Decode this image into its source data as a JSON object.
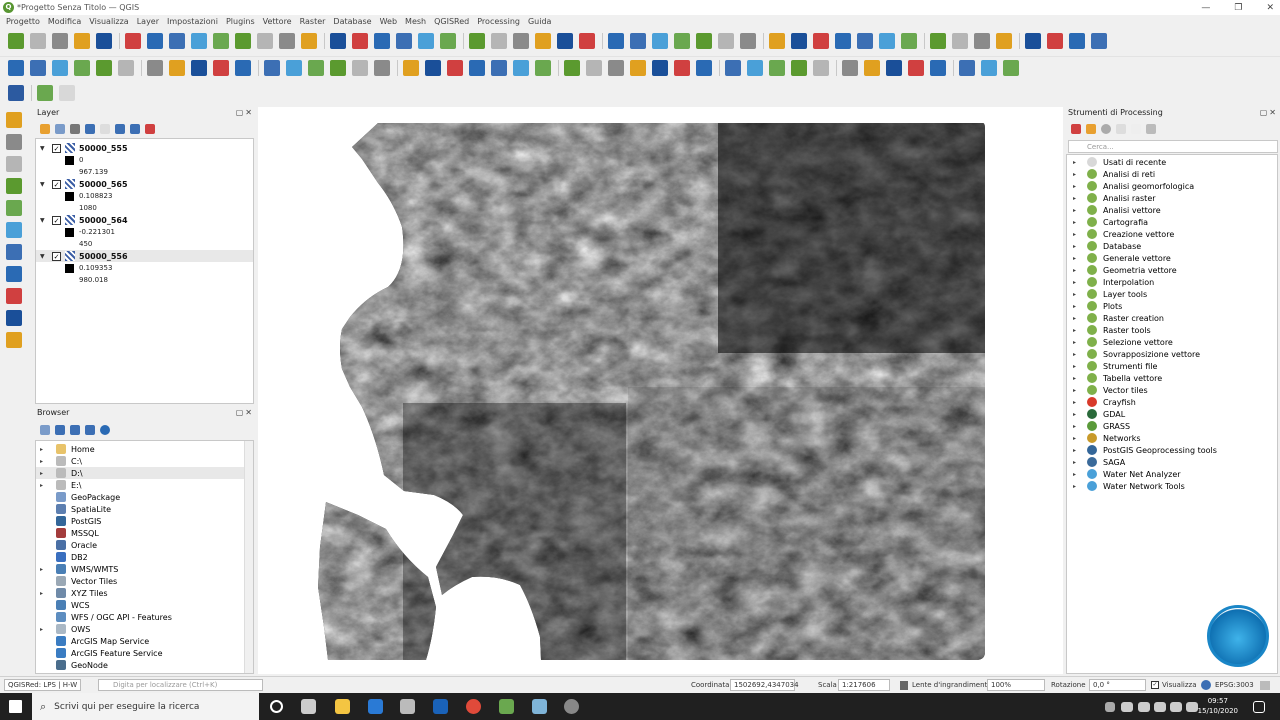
{
  "window": {
    "title": "*Progetto Senza Titolo — QGIS",
    "logo": "Q",
    "controls": [
      "—",
      "❐",
      "✕"
    ]
  },
  "menu": [
    "Progetto",
    "Modifica",
    "Visualizza",
    "Layer",
    "Impostazioni",
    "Plugins",
    "Vettore",
    "Raster",
    "Database",
    "Web",
    "Mesh",
    "QGISRed",
    "Processing",
    "Guida"
  ],
  "layers_panel": {
    "title": "Layer",
    "layers": [
      {
        "name": "50000_555",
        "min": "0",
        "max": "967.139"
      },
      {
        "name": "50000_565",
        "min": "0.108823",
        "max": "1080"
      },
      {
        "name": "50000_564",
        "min": "-0.221301",
        "max": "450"
      },
      {
        "name": "50000_556",
        "min": "0.109353",
        "max": "980.018"
      }
    ]
  },
  "browser_panel": {
    "title": "Browser",
    "items": [
      {
        "label": "Home",
        "expand": "▸",
        "icon": "folder-icon",
        "color": "#e8c36a"
      },
      {
        "label": "C:\\",
        "expand": "▸",
        "icon": "drive-icon",
        "color": "#bbbbbb"
      },
      {
        "label": "D:\\",
        "expand": "▸",
        "icon": "drive-icon",
        "color": "#bbbbbb"
      },
      {
        "label": "E:\\",
        "expand": "▸",
        "icon": "drive-icon",
        "color": "#bbbbbb"
      },
      {
        "label": "GeoPackage",
        "expand": "",
        "icon": "geopackage-icon",
        "color": "#7a9bc9"
      },
      {
        "label": "SpatiaLite",
        "expand": "",
        "icon": "spatialite-icon",
        "color": "#5d7fb0"
      },
      {
        "label": "PostGIS",
        "expand": "",
        "icon": "postgis-icon",
        "color": "#336699"
      },
      {
        "label": "MSSQL",
        "expand": "",
        "icon": "mssql-icon",
        "color": "#a33c3c"
      },
      {
        "label": "Oracle",
        "expand": "",
        "icon": "oracle-icon",
        "color": "#4a6fa5"
      },
      {
        "label": "DB2",
        "expand": "",
        "icon": "db2-icon",
        "color": "#3a6fbf"
      },
      {
        "label": "WMS/WMTS",
        "expand": "▸",
        "icon": "globe-icon",
        "color": "#4a7fb5"
      },
      {
        "label": "Vector Tiles",
        "expand": "",
        "icon": "vector-tiles-icon",
        "color": "#9aa8b5"
      },
      {
        "label": "XYZ Tiles",
        "expand": "▸",
        "icon": "grid-icon",
        "color": "#6f8aa8"
      },
      {
        "label": "WCS",
        "expand": "",
        "icon": "globe-icon",
        "color": "#4a7fb5"
      },
      {
        "label": "WFS / OGC API - Features",
        "expand": "",
        "icon": "wfs-icon",
        "color": "#5d8dc0"
      },
      {
        "label": "OWS",
        "expand": "▸",
        "icon": "ows-icon",
        "color": "#aab8c5"
      },
      {
        "label": "ArcGIS Map Service",
        "expand": "",
        "icon": "arcgis-icon",
        "color": "#3a7cc2"
      },
      {
        "label": "ArcGIS Feature Service",
        "expand": "",
        "icon": "arcgis-icon",
        "color": "#3a7cc2"
      },
      {
        "label": "GeoNode",
        "expand": "",
        "icon": "geonode-icon",
        "color": "#4a6d8c"
      }
    ]
  },
  "processing_panel": {
    "title": "Strumenti di Processing",
    "search_placeholder": "Cerca...",
    "items": [
      {
        "label": "Usati di recente",
        "icon": "clock-icon",
        "color": "#d8d8d8"
      },
      {
        "label": "Analisi di reti",
        "icon": "qgis-icon",
        "color": "#7fb04a"
      },
      {
        "label": "Analisi geomorfologica",
        "icon": "qgis-icon",
        "color": "#7fb04a"
      },
      {
        "label": "Analisi raster",
        "icon": "qgis-icon",
        "color": "#7fb04a"
      },
      {
        "label": "Analisi vettore",
        "icon": "qgis-icon",
        "color": "#7fb04a"
      },
      {
        "label": "Cartografia",
        "icon": "qgis-icon",
        "color": "#7fb04a"
      },
      {
        "label": "Creazione vettore",
        "icon": "qgis-icon",
        "color": "#7fb04a"
      },
      {
        "label": "Database",
        "icon": "qgis-icon",
        "color": "#7fb04a"
      },
      {
        "label": "Generale vettore",
        "icon": "qgis-icon",
        "color": "#7fb04a"
      },
      {
        "label": "Geometria vettore",
        "icon": "qgis-icon",
        "color": "#7fb04a"
      },
      {
        "label": "Interpolation",
        "icon": "qgis-icon",
        "color": "#7fb04a"
      },
      {
        "label": "Layer tools",
        "icon": "qgis-icon",
        "color": "#7fb04a"
      },
      {
        "label": "Plots",
        "icon": "qgis-icon",
        "color": "#7fb04a"
      },
      {
        "label": "Raster creation",
        "icon": "qgis-icon",
        "color": "#7fb04a"
      },
      {
        "label": "Raster tools",
        "icon": "qgis-icon",
        "color": "#7fb04a"
      },
      {
        "label": "Selezione vettore",
        "icon": "qgis-icon",
        "color": "#7fb04a"
      },
      {
        "label": "Sovrapposizione vettore",
        "icon": "qgis-icon",
        "color": "#7fb04a"
      },
      {
        "label": "Strumenti file",
        "icon": "qgis-icon",
        "color": "#7fb04a"
      },
      {
        "label": "Tabella vettore",
        "icon": "qgis-icon",
        "color": "#7fb04a"
      },
      {
        "label": "Vector tiles",
        "icon": "qgis-icon",
        "color": "#7fb04a"
      },
      {
        "label": "Crayfish",
        "icon": "crayfish-icon",
        "color": "#d83a2a"
      },
      {
        "label": "GDAL",
        "icon": "gdal-icon",
        "color": "#2a6a3a"
      },
      {
        "label": "GRASS",
        "icon": "grass-icon",
        "color": "#5a9a3a"
      },
      {
        "label": "Networks",
        "icon": "networks-icon",
        "color": "#c89a2a"
      },
      {
        "label": "PostGIS Geoprocessing tools",
        "icon": "postgis-icon",
        "color": "#336699"
      },
      {
        "label": "SAGA",
        "icon": "saga-icon",
        "color": "#3a6a9a"
      },
      {
        "label": "Water Net Analyzer",
        "icon": "water-icon",
        "color": "#4aa0d8"
      },
      {
        "label": "Water Network Tools",
        "icon": "water-icon",
        "color": "#4aa0d8"
      }
    ]
  },
  "status": {
    "qgisred": "QGISRed: LPS | H-W",
    "locator_placeholder": "Digita per localizzare (Ctrl+K)",
    "coord_label": "Coordinata",
    "coord_value": "1502692,4347034",
    "scale_label": "Scala",
    "scale_value": "1:217606",
    "magnifier_label": "Lente d'ingrandimento",
    "magnifier_value": "100%",
    "rotation_label": "Rotazione",
    "rotation_value": "0,0 °",
    "render_label": "Visualizza",
    "crs": "EPSG:3003"
  },
  "taskbar": {
    "search_placeholder": "Scrivi qui per eseguire la ricerca",
    "time": "09:57",
    "date": "15/10/2020"
  },
  "toolbar_colors": {
    "primary": "#3c6fb4",
    "accent": "#5b9a2f",
    "warn": "#e0a020"
  }
}
